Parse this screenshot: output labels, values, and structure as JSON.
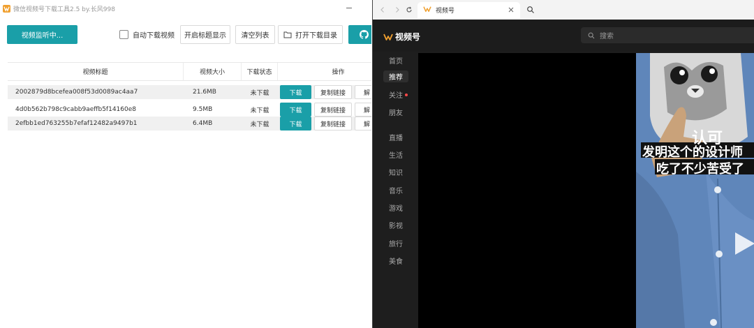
{
  "app": {
    "title": "微信视频号下载工具2.5 by.长风998",
    "toolbar": {
      "monitor_label": "视频监听中...",
      "auto_download_label": "自动下载视频",
      "show_titles_label": "开启标题显示",
      "clear_list_label": "清空列表",
      "open_dir_label": "打开下载目录"
    },
    "table": {
      "headers": [
        "视频标题",
        "视频大小",
        "下载状态",
        "操作"
      ],
      "rows": [
        {
          "title": "2002879d8bcefea008f53d0089ac4aa7",
          "size": "21.6MB",
          "status": "未下载",
          "download": "下载",
          "copy": "复制链接",
          "parse": "解"
        },
        {
          "title": "4d0b562b798c9cabb9aeffb5f14160e8",
          "size": "9.5MB",
          "status": "未下载",
          "download": "下载",
          "copy": "复制链接",
          "parse": "解"
        },
        {
          "title": "2efbb1ed763255b7efaf12482a9497b1",
          "size": "6.4MB",
          "status": "未下载",
          "download": "下载",
          "copy": "复制链接",
          "parse": "解"
        }
      ]
    }
  },
  "browser": {
    "tab_title": "视频号",
    "site_name": "视频号",
    "search_placeholder": "搜索",
    "nav": [
      "首页",
      "推荐",
      "关注",
      "朋友",
      "直播",
      "生活",
      "知识",
      "音乐",
      "游戏",
      "影视",
      "旅行",
      "美食"
    ],
    "active_nav": "推荐",
    "video_captions": [
      "认可",
      "发明这个的设计师",
      "吃了不少苦受了"
    ]
  },
  "colors": {
    "accent": "#1a9fa8",
    "logo_orange": "#f0a030",
    "dark_bg": "#1e1e1e",
    "notify_red": "#ff4a4a"
  }
}
